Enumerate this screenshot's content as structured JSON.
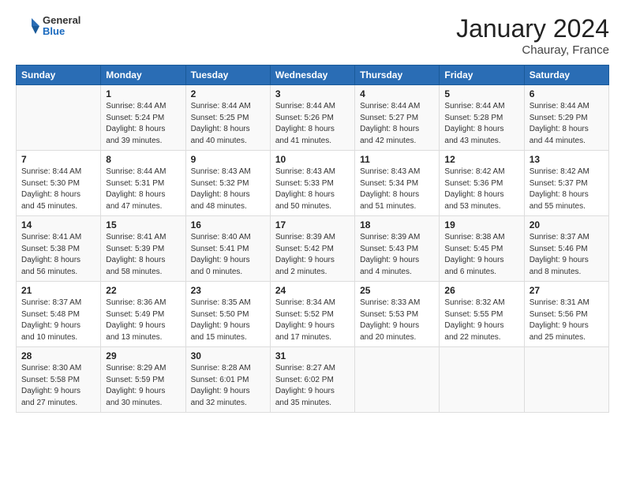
{
  "header": {
    "logo_general": "General",
    "logo_blue": "Blue",
    "title": "January 2024",
    "location": "Chauray, France"
  },
  "days_header": [
    "Sunday",
    "Monday",
    "Tuesday",
    "Wednesday",
    "Thursday",
    "Friday",
    "Saturday"
  ],
  "weeks": [
    [
      {
        "day": "",
        "info": ""
      },
      {
        "day": "1",
        "info": "Sunrise: 8:44 AM\nSunset: 5:24 PM\nDaylight: 8 hours\nand 39 minutes."
      },
      {
        "day": "2",
        "info": "Sunrise: 8:44 AM\nSunset: 5:25 PM\nDaylight: 8 hours\nand 40 minutes."
      },
      {
        "day": "3",
        "info": "Sunrise: 8:44 AM\nSunset: 5:26 PM\nDaylight: 8 hours\nand 41 minutes."
      },
      {
        "day": "4",
        "info": "Sunrise: 8:44 AM\nSunset: 5:27 PM\nDaylight: 8 hours\nand 42 minutes."
      },
      {
        "day": "5",
        "info": "Sunrise: 8:44 AM\nSunset: 5:28 PM\nDaylight: 8 hours\nand 43 minutes."
      },
      {
        "day": "6",
        "info": "Sunrise: 8:44 AM\nSunset: 5:29 PM\nDaylight: 8 hours\nand 44 minutes."
      }
    ],
    [
      {
        "day": "7",
        "info": "Sunrise: 8:44 AM\nSunset: 5:30 PM\nDaylight: 8 hours\nand 45 minutes."
      },
      {
        "day": "8",
        "info": "Sunrise: 8:44 AM\nSunset: 5:31 PM\nDaylight: 8 hours\nand 47 minutes."
      },
      {
        "day": "9",
        "info": "Sunrise: 8:43 AM\nSunset: 5:32 PM\nDaylight: 8 hours\nand 48 minutes."
      },
      {
        "day": "10",
        "info": "Sunrise: 8:43 AM\nSunset: 5:33 PM\nDaylight: 8 hours\nand 50 minutes."
      },
      {
        "day": "11",
        "info": "Sunrise: 8:43 AM\nSunset: 5:34 PM\nDaylight: 8 hours\nand 51 minutes."
      },
      {
        "day": "12",
        "info": "Sunrise: 8:42 AM\nSunset: 5:36 PM\nDaylight: 8 hours\nand 53 minutes."
      },
      {
        "day": "13",
        "info": "Sunrise: 8:42 AM\nSunset: 5:37 PM\nDaylight: 8 hours\nand 55 minutes."
      }
    ],
    [
      {
        "day": "14",
        "info": "Sunrise: 8:41 AM\nSunset: 5:38 PM\nDaylight: 8 hours\nand 56 minutes."
      },
      {
        "day": "15",
        "info": "Sunrise: 8:41 AM\nSunset: 5:39 PM\nDaylight: 8 hours\nand 58 minutes."
      },
      {
        "day": "16",
        "info": "Sunrise: 8:40 AM\nSunset: 5:41 PM\nDaylight: 9 hours\nand 0 minutes."
      },
      {
        "day": "17",
        "info": "Sunrise: 8:39 AM\nSunset: 5:42 PM\nDaylight: 9 hours\nand 2 minutes."
      },
      {
        "day": "18",
        "info": "Sunrise: 8:39 AM\nSunset: 5:43 PM\nDaylight: 9 hours\nand 4 minutes."
      },
      {
        "day": "19",
        "info": "Sunrise: 8:38 AM\nSunset: 5:45 PM\nDaylight: 9 hours\nand 6 minutes."
      },
      {
        "day": "20",
        "info": "Sunrise: 8:37 AM\nSunset: 5:46 PM\nDaylight: 9 hours\nand 8 minutes."
      }
    ],
    [
      {
        "day": "21",
        "info": "Sunrise: 8:37 AM\nSunset: 5:48 PM\nDaylight: 9 hours\nand 10 minutes."
      },
      {
        "day": "22",
        "info": "Sunrise: 8:36 AM\nSunset: 5:49 PM\nDaylight: 9 hours\nand 13 minutes."
      },
      {
        "day": "23",
        "info": "Sunrise: 8:35 AM\nSunset: 5:50 PM\nDaylight: 9 hours\nand 15 minutes."
      },
      {
        "day": "24",
        "info": "Sunrise: 8:34 AM\nSunset: 5:52 PM\nDaylight: 9 hours\nand 17 minutes."
      },
      {
        "day": "25",
        "info": "Sunrise: 8:33 AM\nSunset: 5:53 PM\nDaylight: 9 hours\nand 20 minutes."
      },
      {
        "day": "26",
        "info": "Sunrise: 8:32 AM\nSunset: 5:55 PM\nDaylight: 9 hours\nand 22 minutes."
      },
      {
        "day": "27",
        "info": "Sunrise: 8:31 AM\nSunset: 5:56 PM\nDaylight: 9 hours\nand 25 minutes."
      }
    ],
    [
      {
        "day": "28",
        "info": "Sunrise: 8:30 AM\nSunset: 5:58 PM\nDaylight: 9 hours\nand 27 minutes."
      },
      {
        "day": "29",
        "info": "Sunrise: 8:29 AM\nSunset: 5:59 PM\nDaylight: 9 hours\nand 30 minutes."
      },
      {
        "day": "30",
        "info": "Sunrise: 8:28 AM\nSunset: 6:01 PM\nDaylight: 9 hours\nand 32 minutes."
      },
      {
        "day": "31",
        "info": "Sunrise: 8:27 AM\nSunset: 6:02 PM\nDaylight: 9 hours\nand 35 minutes."
      },
      {
        "day": "",
        "info": ""
      },
      {
        "day": "",
        "info": ""
      },
      {
        "day": "",
        "info": ""
      }
    ]
  ]
}
